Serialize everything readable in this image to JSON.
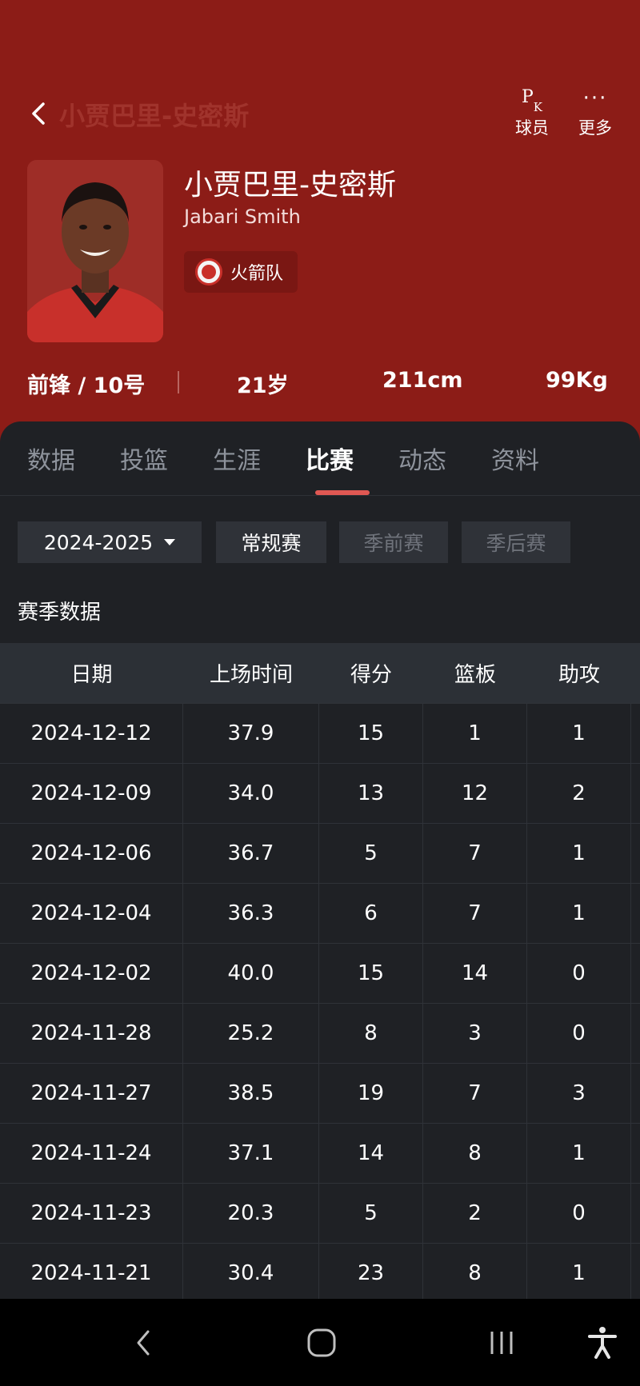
{
  "header": {
    "nav_title": "小贾巴里-史密斯",
    "actions": [
      {
        "icon": "pk-icon",
        "label": "球员"
      },
      {
        "icon": "more-dots-icon",
        "label": "更多"
      }
    ],
    "player": {
      "name_cn": "小贾巴里-史密斯",
      "name_en": "Jabari Smith",
      "team": "火箭队",
      "position_number": "前锋 / 10号",
      "age": "21岁",
      "height": "211cm",
      "weight": "99Kg"
    }
  },
  "tabs": [
    "数据",
    "投篮",
    "生涯",
    "比赛",
    "动态",
    "资料"
  ],
  "active_tab": "比赛",
  "filters": {
    "season": "2024-2025",
    "types": [
      "常规赛",
      "季前赛",
      "季后赛"
    ]
  },
  "section_title": "赛季数据",
  "table": {
    "headers": [
      "日期",
      "上场时间",
      "得分",
      "篮板",
      "助攻"
    ],
    "rows": [
      [
        "2024-12-12",
        "37.9",
        "15",
        "1",
        "1"
      ],
      [
        "2024-12-09",
        "34.0",
        "13",
        "12",
        "2"
      ],
      [
        "2024-12-06",
        "36.7",
        "5",
        "7",
        "1"
      ],
      [
        "2024-12-04",
        "36.3",
        "6",
        "7",
        "1"
      ],
      [
        "2024-12-02",
        "40.0",
        "15",
        "14",
        "0"
      ],
      [
        "2024-11-28",
        "25.2",
        "8",
        "3",
        "0"
      ],
      [
        "2024-11-27",
        "38.5",
        "19",
        "7",
        "3"
      ],
      [
        "2024-11-24",
        "37.1",
        "14",
        "8",
        "1"
      ],
      [
        "2024-11-23",
        "20.3",
        "5",
        "2",
        "0"
      ],
      [
        "2024-11-21",
        "30.4",
        "23",
        "8",
        "1"
      ]
    ]
  },
  "colors": {
    "header_bg": "#8c1c17",
    "panel_bg": "#1f2125",
    "accent": "#e05853"
  }
}
